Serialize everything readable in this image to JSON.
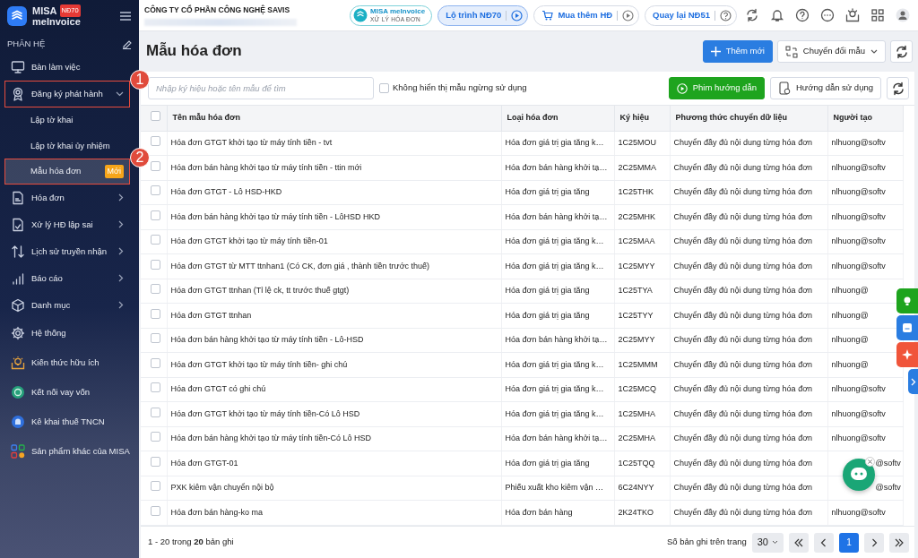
{
  "sidebar": {
    "logo": {
      "brand": "MISA",
      "product": "meInvoice",
      "badge": "NĐ70"
    },
    "section_title": "PHÂN HỆ",
    "items": [
      {
        "label": "Bàn làm việc",
        "kind": "item",
        "selected": false
      },
      {
        "label": "Đăng ký phát hành",
        "kind": "group",
        "expanded": true,
        "selected": false,
        "callout": "1"
      },
      {
        "label": "Lập tờ khai",
        "kind": "sub",
        "selected": false
      },
      {
        "label": "Lập tờ khai ủy nhiệm",
        "kind": "sub",
        "selected": false
      },
      {
        "label": "Mẫu hóa đơn",
        "kind": "sub",
        "selected": true,
        "badge": "Mới",
        "callout": "2"
      },
      {
        "label": "Hóa đơn",
        "kind": "group",
        "expanded": false,
        "selected": false
      },
      {
        "label": "Xử lý HĐ lập sai",
        "kind": "group",
        "expanded": false,
        "selected": false
      },
      {
        "label": "Lịch sử truyền nhận",
        "kind": "group",
        "expanded": false,
        "selected": false
      },
      {
        "label": "Báo cáo",
        "kind": "group",
        "expanded": false,
        "selected": false
      },
      {
        "label": "Danh mục",
        "kind": "group",
        "expanded": false,
        "selected": false
      },
      {
        "label": "Hệ thống",
        "kind": "item",
        "selected": false
      },
      {
        "label": "Kiến thức hữu ích",
        "kind": "item",
        "selected": false
      },
      {
        "label": "Kết nối vay vốn",
        "kind": "item",
        "selected": false
      },
      {
        "label": "Kê khai thuế TNCN",
        "kind": "item",
        "selected": false
      },
      {
        "label": "Sản phẩm khác của MISA",
        "kind": "item",
        "selected": false
      }
    ]
  },
  "topbar": {
    "company": "CÔNG TY CỔ PHẦN CÔNG NGHỆ SAVIS",
    "product_badge": {
      "name": "MISA meInvoice",
      "subtitle": "XỬ LÝ HÓA ĐƠN"
    },
    "pills": [
      {
        "label": "Lộ trình NĐ70",
        "selected": true
      },
      {
        "label": "Mua thêm HĐ",
        "selected": false
      },
      {
        "label": "Quay lại NĐ51",
        "selected": false
      }
    ]
  },
  "page": {
    "title": "Mẫu hóa đơn",
    "buttons": [
      "Thêm mới",
      "Chuyển đổi mẫu"
    ]
  },
  "toolbar": {
    "search": {
      "placeholder": "Nhập ký hiệu hoặc tên mẫu để tìm"
    },
    "hide_inactive": {
      "label": "Không hiển thị mẫu ngừng sử dụng",
      "checked": false
    },
    "buttons": [
      "Phim hướng dẫn",
      "Hướng dẫn sử dụng"
    ]
  },
  "table": {
    "all_selected": false,
    "columns": [
      "Tên mẫu hóa đơn",
      "Loại hóa đơn",
      "Ký hiệu",
      "Phương thức chuyển dữ liệu",
      "Người tạo"
    ],
    "rows": [
      {
        "selected": false,
        "cells": [
          "Hóa đơn GTGT khởi tạo từ máy tính tiền - tvt",
          "Hóa đơn giá trị gia tăng k…",
          "1C25MOU",
          "Chuyển đầy đủ nội dung từng hóa đơn",
          "nlhuong@softv"
        ]
      },
      {
        "selected": false,
        "cells": [
          "Hóa đơn bán hàng khởi tạo từ máy tính tiền - ttin mới",
          "Hóa đơn bán hàng khởi tạ…",
          "2C25MMA",
          "Chuyển đầy đủ nội dung từng hóa đơn",
          "nlhuong@softv"
        ]
      },
      {
        "selected": false,
        "cells": [
          "Hóa đơn GTGT - Lô HSD-HKD",
          "Hóa đơn giá trị gia tăng",
          "1C25THK",
          "Chuyển đầy đủ nội dung từng hóa đơn",
          "nlhuong@softv"
        ]
      },
      {
        "selected": false,
        "cells": [
          "Hóa đơn bán hàng khởi tạo từ máy tính tiền - LôHSD HKD",
          "Hóa đơn bán hàng khởi tạ…",
          "2C25MHK",
          "Chuyển đầy đủ nội dung từng hóa đơn",
          "nlhuong@softv"
        ]
      },
      {
        "selected": false,
        "cells": [
          "Hóa đơn GTGT khởi tạo từ máy tính tiền-01",
          "Hóa đơn giá trị gia tăng k…",
          "1C25MAA",
          "Chuyển đầy đủ nội dung từng hóa đơn",
          "nlhuong@softv"
        ]
      },
      {
        "selected": false,
        "cells": [
          "Hóa đơn GTGT từ MTT ttnhan1 (Có CK, đơn giá , thành tiền trước thuế)",
          "Hóa đơn giá trị gia tăng k…",
          "1C25MYY",
          "Chuyển đầy đủ nội dung từng hóa đơn",
          "nlhuong@softv"
        ]
      },
      {
        "selected": false,
        "cells": [
          "Hóa đơn GTGT ttnhan (Tỉ lệ ck, tt trước thuế gtgt)",
          "Hóa đơn giá trị gia tăng",
          "1C25TYA",
          "Chuyển đầy đủ nội dung từng hóa đơn",
          "nlhuong@"
        ]
      },
      {
        "selected": false,
        "cells": [
          "Hóa đơn GTGT ttnhan",
          "Hóa đơn giá trị gia tăng",
          "1C25TYY",
          "Chuyển đầy đủ nội dung từng hóa đơn",
          "nlhuong@"
        ]
      },
      {
        "selected": false,
        "cells": [
          "Hóa đơn bán hàng khởi tạo từ máy tính tiền - Lô-HSD",
          "Hóa đơn bán hàng khởi tạ…",
          "2C25MYY",
          "Chuyển đầy đủ nội dung từng hóa đơn",
          "nlhuong@"
        ]
      },
      {
        "selected": false,
        "cells": [
          "Hóa đơn GTGT khởi tạo từ máy tính tiền- ghi chú",
          "Hóa đơn giá trị gia tăng k…",
          "1C25MMM",
          "Chuyển đầy đủ nội dung từng hóa đơn",
          "nlhuong@"
        ]
      },
      {
        "selected": false,
        "cells": [
          "Hóa đơn GTGT có ghi chú",
          "Hóa đơn giá trị gia tăng k…",
          "1C25MCQ",
          "Chuyển đầy đủ nội dung từng hóa đơn",
          "nlhuong@softv"
        ]
      },
      {
        "selected": false,
        "cells": [
          "Hóa đơn GTGT khởi tạo từ máy tính tiền-Có Lô HSD",
          "Hóa đơn giá trị gia tăng k…",
          "1C25MHA",
          "Chuyển đầy đủ nội dung từng hóa đơn",
          "nlhuong@softv"
        ]
      },
      {
        "selected": false,
        "cells": [
          "Hóa đơn bán hàng khởi tạo từ máy tính tiền-Có Lô HSD",
          "Hóa đơn bán hàng khởi tạ…",
          "2C25MHA",
          "Chuyển đầy đủ nội dung từng hóa đơn",
          "nlhuong@softv"
        ]
      },
      {
        "selected": false,
        "cells": [
          "Hóa đơn GTGT-01",
          "Hóa đơn giá trị gia tăng",
          "1C25TQQ",
          "Chuyển đầy đủ nội dung từng hóa đơn",
          "@softv"
        ],
        "creator_indented": true
      },
      {
        "selected": false,
        "cells": [
          "PXK kiêm vận chuyển nội bộ",
          "Phiếu xuất kho kiêm vận …",
          "6C24NYY",
          "Chuyển đầy đủ nội dung từng hóa đơn",
          "@softv"
        ],
        "creator_indented": true
      },
      {
        "selected": false,
        "cells": [
          "Hóa đơn bán hàng-ko ma",
          "Hóa đơn bán hàng",
          "2K24TKO",
          "Chuyển đầy đủ nội dung từng hóa đơn",
          "nlhuong@softv"
        ]
      }
    ]
  },
  "footer": {
    "summary": "1 - 20 trong **20** bản ghi",
    "page_size_label": "Số bản ghi trên trang",
    "page_size": "30",
    "pages": [
      {
        "label": "1",
        "selected": true
      }
    ]
  }
}
